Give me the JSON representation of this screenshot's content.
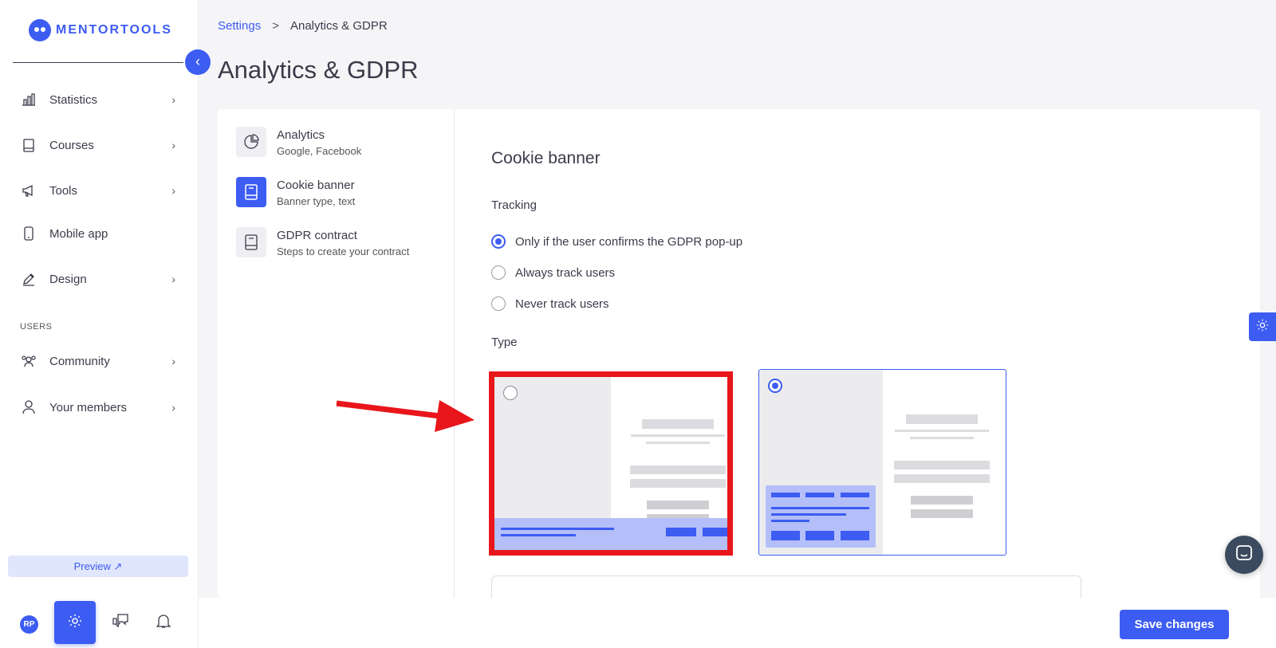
{
  "app": {
    "brand": "MENTORTOOLS",
    "accent_color": "#3c5cf2"
  },
  "sidebar": {
    "collapse_icon": "chevron-left-icon",
    "items": [
      {
        "label": "Statistics",
        "icon": "bar-chart-icon",
        "has_chevron": true
      },
      {
        "label": "Courses",
        "icon": "book-icon",
        "has_chevron": true
      },
      {
        "label": "Tools",
        "icon": "megaphone-icon",
        "has_chevron": true
      },
      {
        "label": "Mobile app",
        "icon": "phone-icon",
        "has_chevron": false
      },
      {
        "label": "Design",
        "icon": "pencil-icon",
        "has_chevron": true
      }
    ],
    "section_users": "USERS",
    "user_items": [
      {
        "label": "Community",
        "icon": "people-icon",
        "has_chevron": true
      },
      {
        "label": "Your members",
        "icon": "user-icon",
        "has_chevron": true
      }
    ],
    "preview_label": "Preview ↗",
    "avatar_initials": "RP"
  },
  "breadcrumb": {
    "parent": "Settings",
    "separator": ">",
    "current": "Analytics & GDPR"
  },
  "page_title": "Analytics & GDPR",
  "subnav": [
    {
      "title": "Analytics",
      "desc": "Google, Facebook",
      "active": false,
      "icon": "pie-chart-icon"
    },
    {
      "title": "Cookie banner",
      "desc": "Banner type, text",
      "active": true,
      "icon": "document-icon"
    },
    {
      "title": "GDPR contract",
      "desc": "Steps to create your contract",
      "active": false,
      "icon": "document-icon"
    }
  ],
  "content": {
    "title": "Cookie banner",
    "tracking_label": "Tracking",
    "tracking_options": [
      {
        "label": "Only if the user confirms the GDPR pop-up",
        "selected": true
      },
      {
        "label": "Always track users",
        "selected": false
      },
      {
        "label": "Never track users",
        "selected": false
      }
    ],
    "type_label": "Type",
    "type_options": [
      {
        "name": "bottom-bar-banner",
        "selected": false,
        "highlighted": true
      },
      {
        "name": "corner-box-banner",
        "selected": true,
        "highlighted": false
      }
    ]
  },
  "footer": {
    "save_label": "Save changes"
  },
  "annotation": {
    "arrow_color": "#e8161b"
  }
}
